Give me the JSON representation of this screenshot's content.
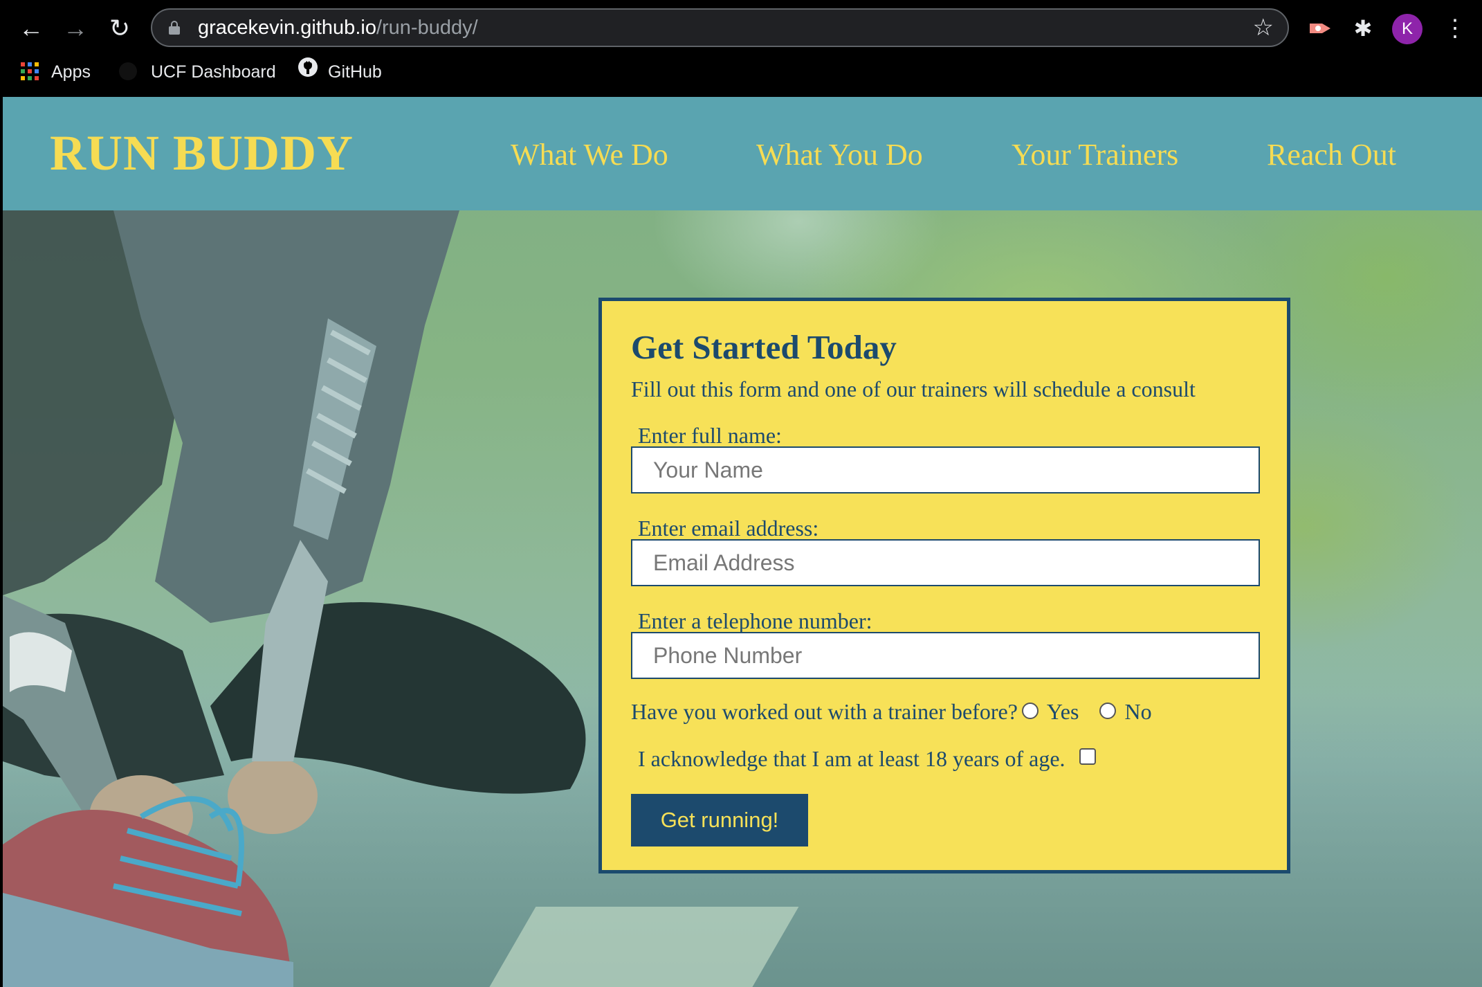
{
  "browser": {
    "url_host": "gracekevin.github.io",
    "url_path": "/run-buddy/",
    "back_icon": "←",
    "forward_icon": "→",
    "reload_icon": "↻",
    "star_icon": "☆",
    "puzzle_icon": "✱",
    "menu_icon": "⋮",
    "profile_initial": "K",
    "profile_color": "#8e24aa",
    "bookmarks": [
      {
        "label": "Apps",
        "icon": "apps-grid-icon"
      },
      {
        "label": "UCF Dashboard",
        "icon": "ucf-icon"
      },
      {
        "label": "GitHub",
        "icon": "github-icon"
      }
    ]
  },
  "site": {
    "logo": "RUN BUDDY",
    "nav": [
      {
        "label": "What We Do"
      },
      {
        "label": "What You Do"
      },
      {
        "label": "Your Trainers"
      },
      {
        "label": "Reach Out"
      }
    ],
    "colors": {
      "header_bg": "#5aa4b0",
      "accent_yellow": "#f6dc53",
      "navy": "#1c4a6d"
    }
  },
  "form": {
    "title": "Get Started Today",
    "subtitle": "Fill out this form and one of our trainers will schedule a consult",
    "fields": [
      {
        "label": "Enter full name:",
        "placeholder": "Your Name",
        "value": ""
      },
      {
        "label": "Enter email address:",
        "placeholder": "Email Address",
        "value": ""
      },
      {
        "label": "Enter a telephone number:",
        "placeholder": "Phone Number",
        "value": ""
      }
    ],
    "trainer_question": "Have you worked out with a trainer before?",
    "trainer_options": [
      "Yes",
      "No"
    ],
    "age_ack": "I acknowledge that I am at least 18 years of age.",
    "submit_label": "Get running!"
  }
}
